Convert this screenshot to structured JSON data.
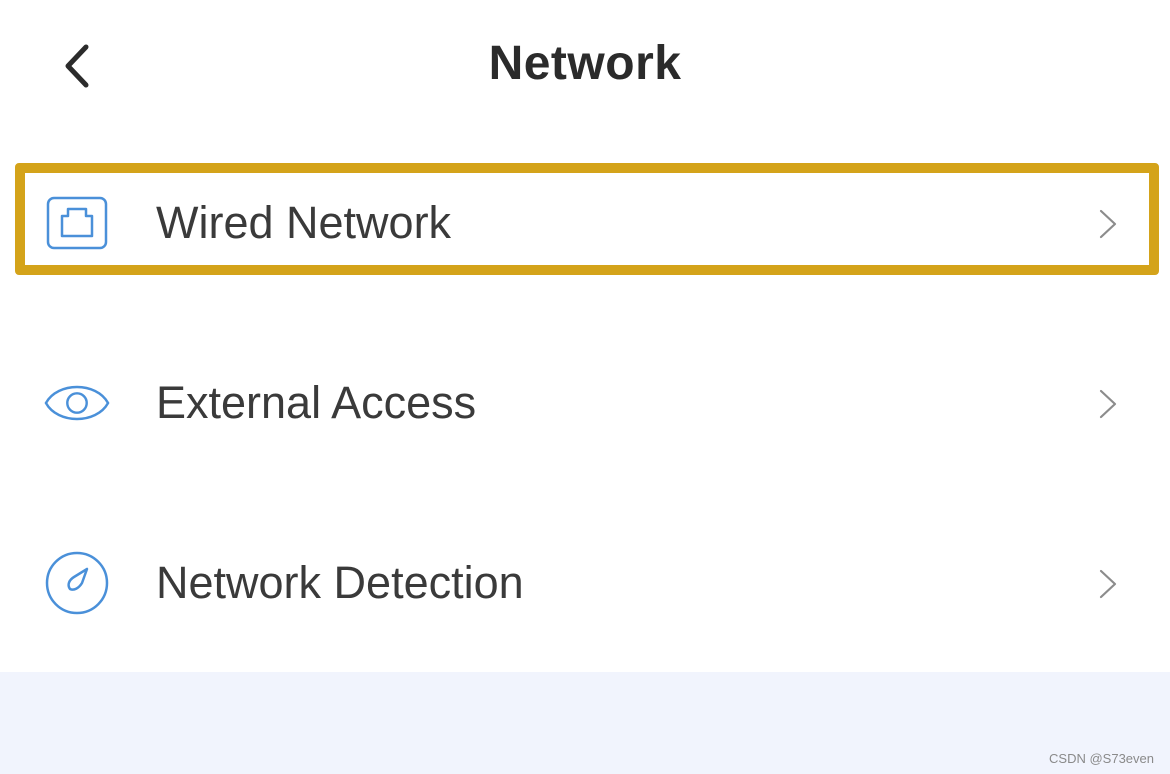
{
  "header": {
    "title": "Network",
    "back_icon": "chevron-left-icon"
  },
  "menu": {
    "items": [
      {
        "label": "Wired Network",
        "icon": "ethernet-port-icon",
        "highlighted": true
      },
      {
        "label": "External Access",
        "icon": "eye-icon",
        "highlighted": false
      },
      {
        "label": "Network Detection",
        "icon": "compass-icon",
        "highlighted": false
      }
    ]
  },
  "colors": {
    "accent_icon": "#4a90d9",
    "highlight_border": "#d4a31a",
    "footer_bg": "#f1f4fd",
    "chevron": "#8c8c8c"
  },
  "watermark": "CSDN @S73even"
}
